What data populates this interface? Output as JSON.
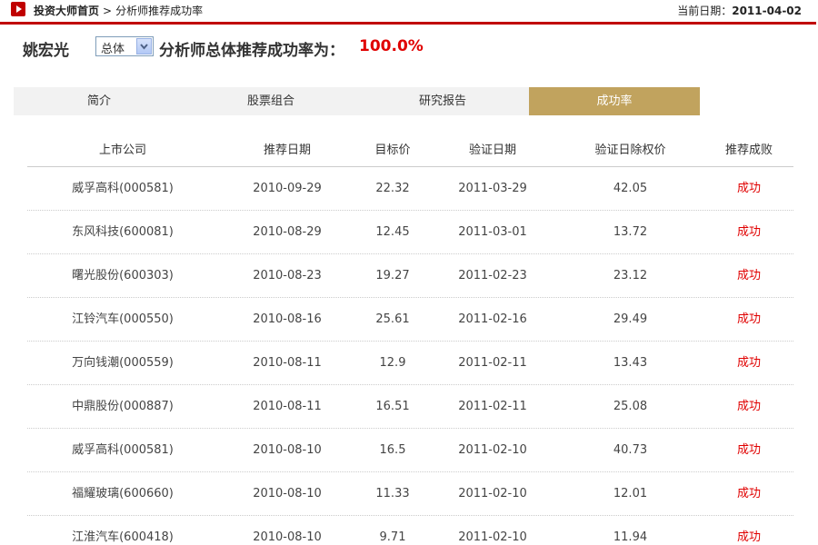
{
  "breadcrumb": {
    "home": "投资大师首页",
    "separator": ">",
    "current": "分析师推荐成功率"
  },
  "date": {
    "label": "当前日期：",
    "value": "2011-04-02"
  },
  "header": {
    "analyst_name": "姚宏光",
    "filter_selected": "总体",
    "rate_label": "分析师总体推荐成功率为：",
    "rate_value": "100.0%"
  },
  "tabs": [
    {
      "label": "简介",
      "active": false
    },
    {
      "label": "股票组合",
      "active": false
    },
    {
      "label": "研究报告",
      "active": false
    },
    {
      "label": "成功率",
      "active": true
    }
  ],
  "table": {
    "columns": [
      "上市公司",
      "推荐日期",
      "目标价",
      "验证日期",
      "验证日除权价",
      "推荐成败"
    ],
    "rows": [
      {
        "company": "威孚高科(000581)",
        "rec_date": "2010-09-29",
        "target": "22.32",
        "verify_date": "2011-03-29",
        "verify_price": "42.05",
        "result": "成功"
      },
      {
        "company": "东风科技(600081)",
        "rec_date": "2010-08-29",
        "target": "12.45",
        "verify_date": "2011-03-01",
        "verify_price": "13.72",
        "result": "成功"
      },
      {
        "company": "曙光股份(600303)",
        "rec_date": "2010-08-23",
        "target": "19.27",
        "verify_date": "2011-02-23",
        "verify_price": "23.12",
        "result": "成功"
      },
      {
        "company": "江铃汽车(000550)",
        "rec_date": "2010-08-16",
        "target": "25.61",
        "verify_date": "2011-02-16",
        "verify_price": "29.49",
        "result": "成功"
      },
      {
        "company": "万向钱潮(000559)",
        "rec_date": "2010-08-11",
        "target": "12.9",
        "verify_date": "2011-02-11",
        "verify_price": "13.43",
        "result": "成功"
      },
      {
        "company": "中鼎股份(000887)",
        "rec_date": "2010-08-11",
        "target": "16.51",
        "verify_date": "2011-02-11",
        "verify_price": "25.08",
        "result": "成功"
      },
      {
        "company": "威孚高科(000581)",
        "rec_date": "2010-08-10",
        "target": "16.5",
        "verify_date": "2011-02-10",
        "verify_price": "40.73",
        "result": "成功"
      },
      {
        "company": "福耀玻璃(600660)",
        "rec_date": "2010-08-10",
        "target": "11.33",
        "verify_date": "2011-02-10",
        "verify_price": "12.01",
        "result": "成功"
      },
      {
        "company": "江淮汽车(600418)",
        "rec_date": "2010-08-10",
        "target": "9.71",
        "verify_date": "2011-02-10",
        "verify_price": "11.94",
        "result": "成功"
      }
    ]
  },
  "colors": {
    "brand_red": "#c00000",
    "active_tab": "#c1a35e",
    "success_text": "#e00000"
  },
  "icons": {
    "home": "play-square-icon",
    "dropdown": "chevron-down-icon"
  }
}
